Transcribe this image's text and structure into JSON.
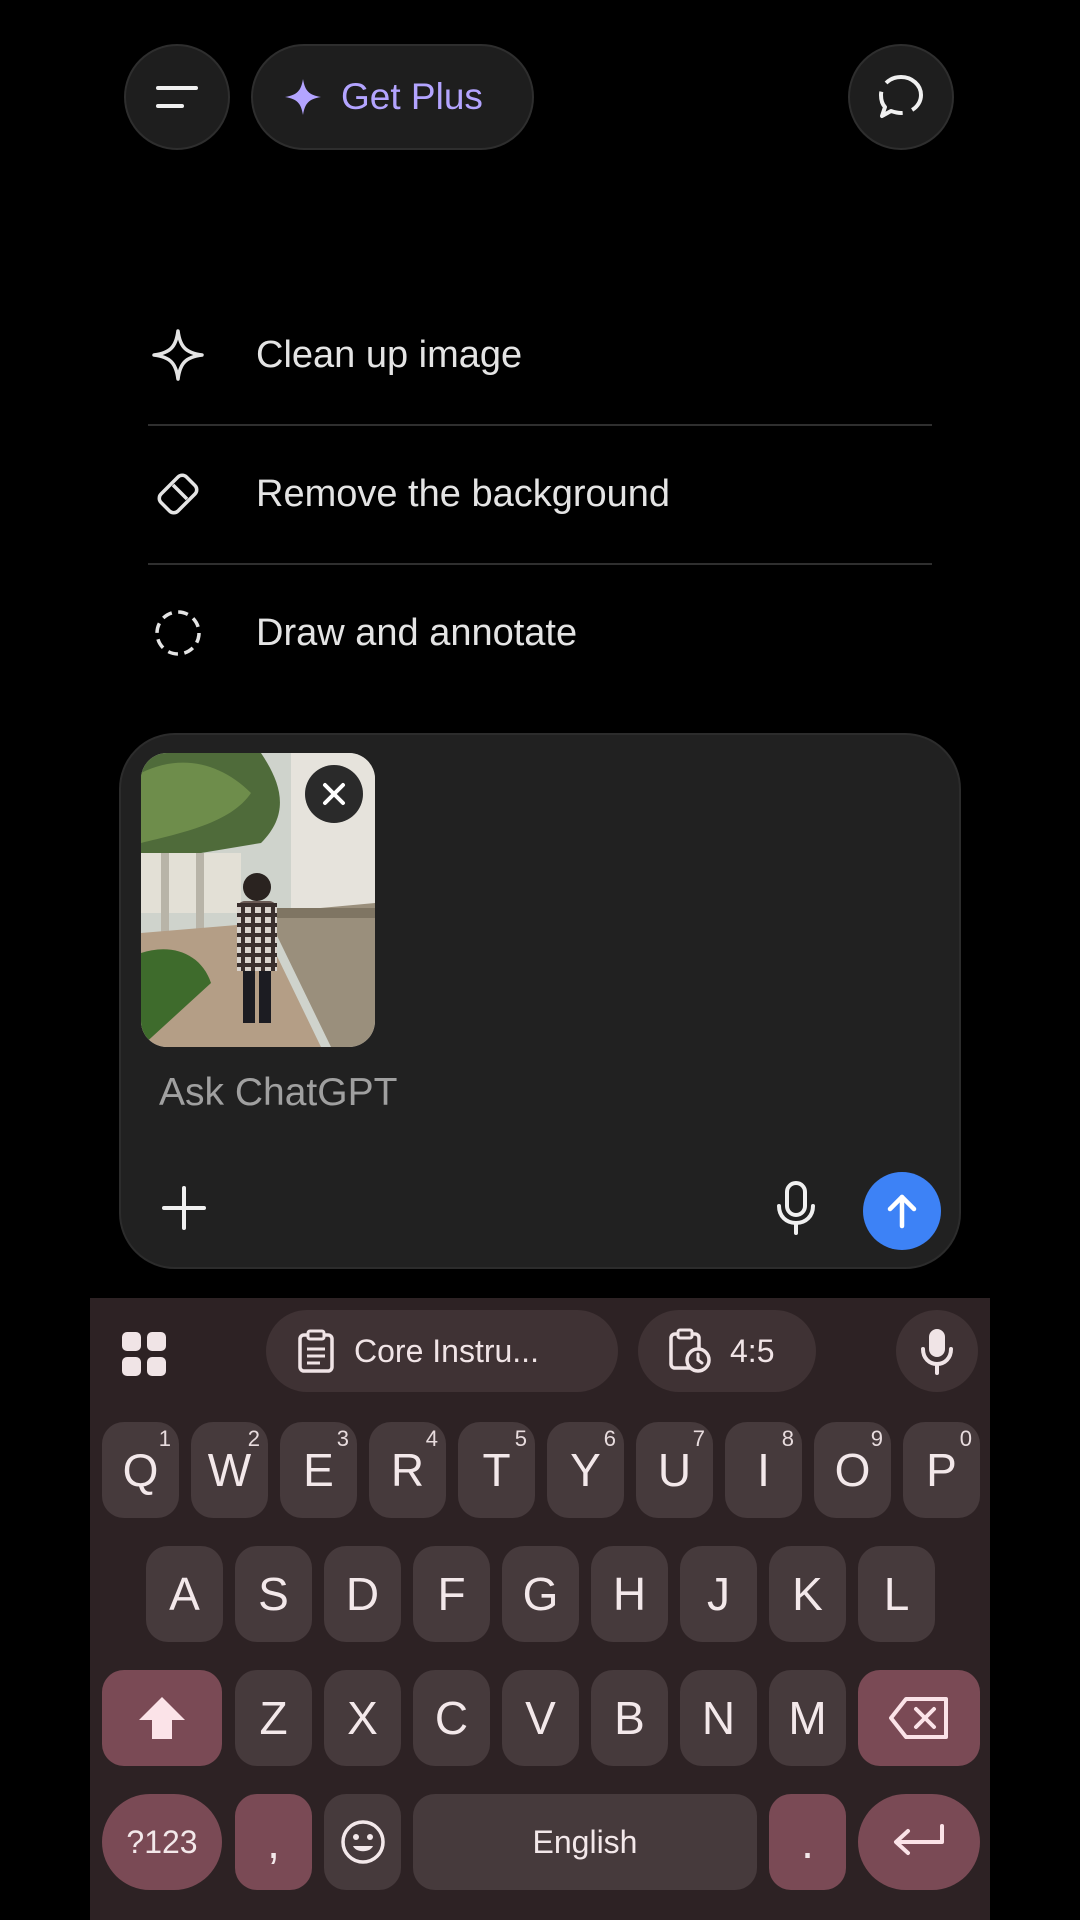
{
  "header": {
    "get_plus_label": "Get Plus",
    "accent_color": "#b3a4ff"
  },
  "suggestions": [
    {
      "icon": "sparkle-icon",
      "label": "Clean up image"
    },
    {
      "icon": "eraser-icon",
      "label": "Remove the background"
    },
    {
      "icon": "dashed-circle-icon",
      "label": "Draw and annotate"
    }
  ],
  "composer": {
    "placeholder": "Ask ChatGPT",
    "attachment": "photo of person standing on a sidewalk by a wall with trees",
    "send_color": "#3d82f6"
  },
  "keyboard": {
    "chips": [
      {
        "icon": "clipboard-icon",
        "label": "Core Instru..."
      },
      {
        "icon": "clipboard-clock-icon",
        "label": "4:5"
      }
    ],
    "row1": [
      {
        "key": "Q",
        "hint": "1"
      },
      {
        "key": "W",
        "hint": "2"
      },
      {
        "key": "E",
        "hint": "3"
      },
      {
        "key": "R",
        "hint": "4"
      },
      {
        "key": "T",
        "hint": "5"
      },
      {
        "key": "Y",
        "hint": "6"
      },
      {
        "key": "U",
        "hint": "7"
      },
      {
        "key": "I",
        "hint": "8"
      },
      {
        "key": "O",
        "hint": "9"
      },
      {
        "key": "P",
        "hint": "0"
      }
    ],
    "row2": [
      "A",
      "S",
      "D",
      "F",
      "G",
      "H",
      "J",
      "K",
      "L"
    ],
    "row3": [
      "Z",
      "X",
      "C",
      "V",
      "B",
      "N",
      "M"
    ],
    "symbols_label": "?123",
    "comma": ",",
    "space_label": "English",
    "period": ".",
    "accent_color": "#7a4a55"
  }
}
